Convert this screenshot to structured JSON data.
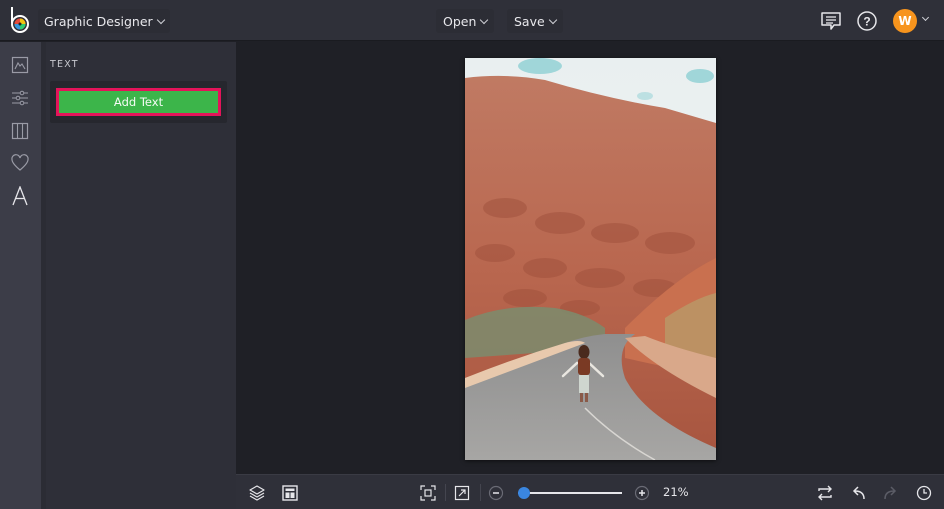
{
  "header": {
    "app_logo": "befunky-logo-icon",
    "design_menu_label": "Graphic Designer",
    "open_label": "Open",
    "save_label": "Save",
    "comment_icon": "comment-icon",
    "help_icon": "help-icon",
    "avatar_initial": "W"
  },
  "sidebar": {
    "items": [
      {
        "name": "image-icon"
      },
      {
        "name": "adjust-sliders-icon"
      },
      {
        "name": "layout-columns-icon"
      },
      {
        "name": "heart-icon"
      },
      {
        "name": "text-icon",
        "active": true
      }
    ]
  },
  "panel": {
    "title": "TEXT",
    "add_text_label": "Add Text"
  },
  "canvas": {
    "image_description": "Woman walking with arms outstretched on a winding desert road between red rock hills under a cloudy sky"
  },
  "bottom_toolbar": {
    "zoom_percent_label": "21%",
    "zoom_fraction": 0.06,
    "left_icons": [
      "layers-icon",
      "layout-icon"
    ],
    "mid_icons": [
      "fit-to-screen-icon",
      "expand-icon",
      "zoom-out-icon",
      "zoom-in-icon"
    ],
    "right_icons": [
      "swap-icon",
      "undo-icon",
      "redo-icon",
      "history-icon"
    ]
  },
  "colors": {
    "accent_green": "#3cb54a",
    "highlight_pink": "#e4145a",
    "avatar_orange": "#f7941d",
    "slider_blue": "#3a86e0"
  }
}
